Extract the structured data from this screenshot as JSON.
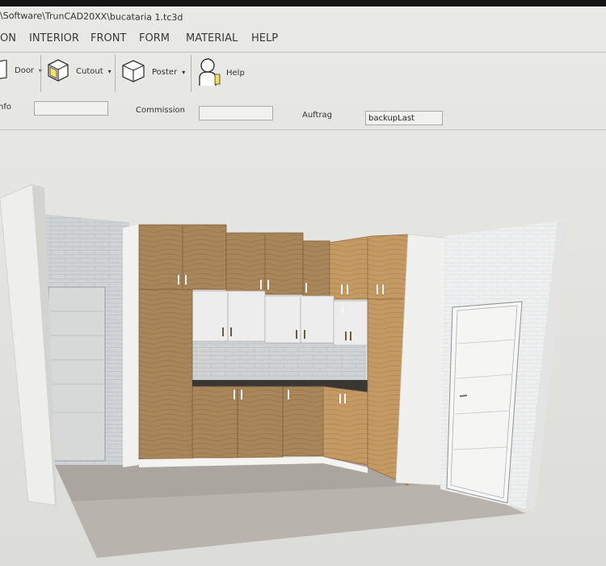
{
  "window": {
    "title_path": "\\Software\\TrunCAD20XX\\bucataria 1.tc3d"
  },
  "menu": {
    "items": [
      "ON",
      "INTERIOR",
      "FRONT",
      "FORM",
      "MATERIAL",
      "HELP"
    ]
  },
  "ribbon": {
    "door_label": "Door",
    "cutout_label": "Cutout",
    "poster_label": "Poster",
    "help_label": "Help",
    "dropdown_glyph": "▾"
  },
  "fields": {
    "first_label": "nfo",
    "first_value": "",
    "commission_label": "Commission",
    "commission_value": "",
    "auftrag_label": "Auftrag",
    "auftrag_value": "backupLast"
  },
  "scene": {
    "description_colors": {
      "wood": "#a9865a",
      "wood_light": "#c49a62",
      "white_cabinet": "#ecedec",
      "countertop": "#3a3632",
      "wall": "#f2f2f0",
      "brick": "#cfd3d5",
      "floor": "#b8b5ae"
    }
  }
}
